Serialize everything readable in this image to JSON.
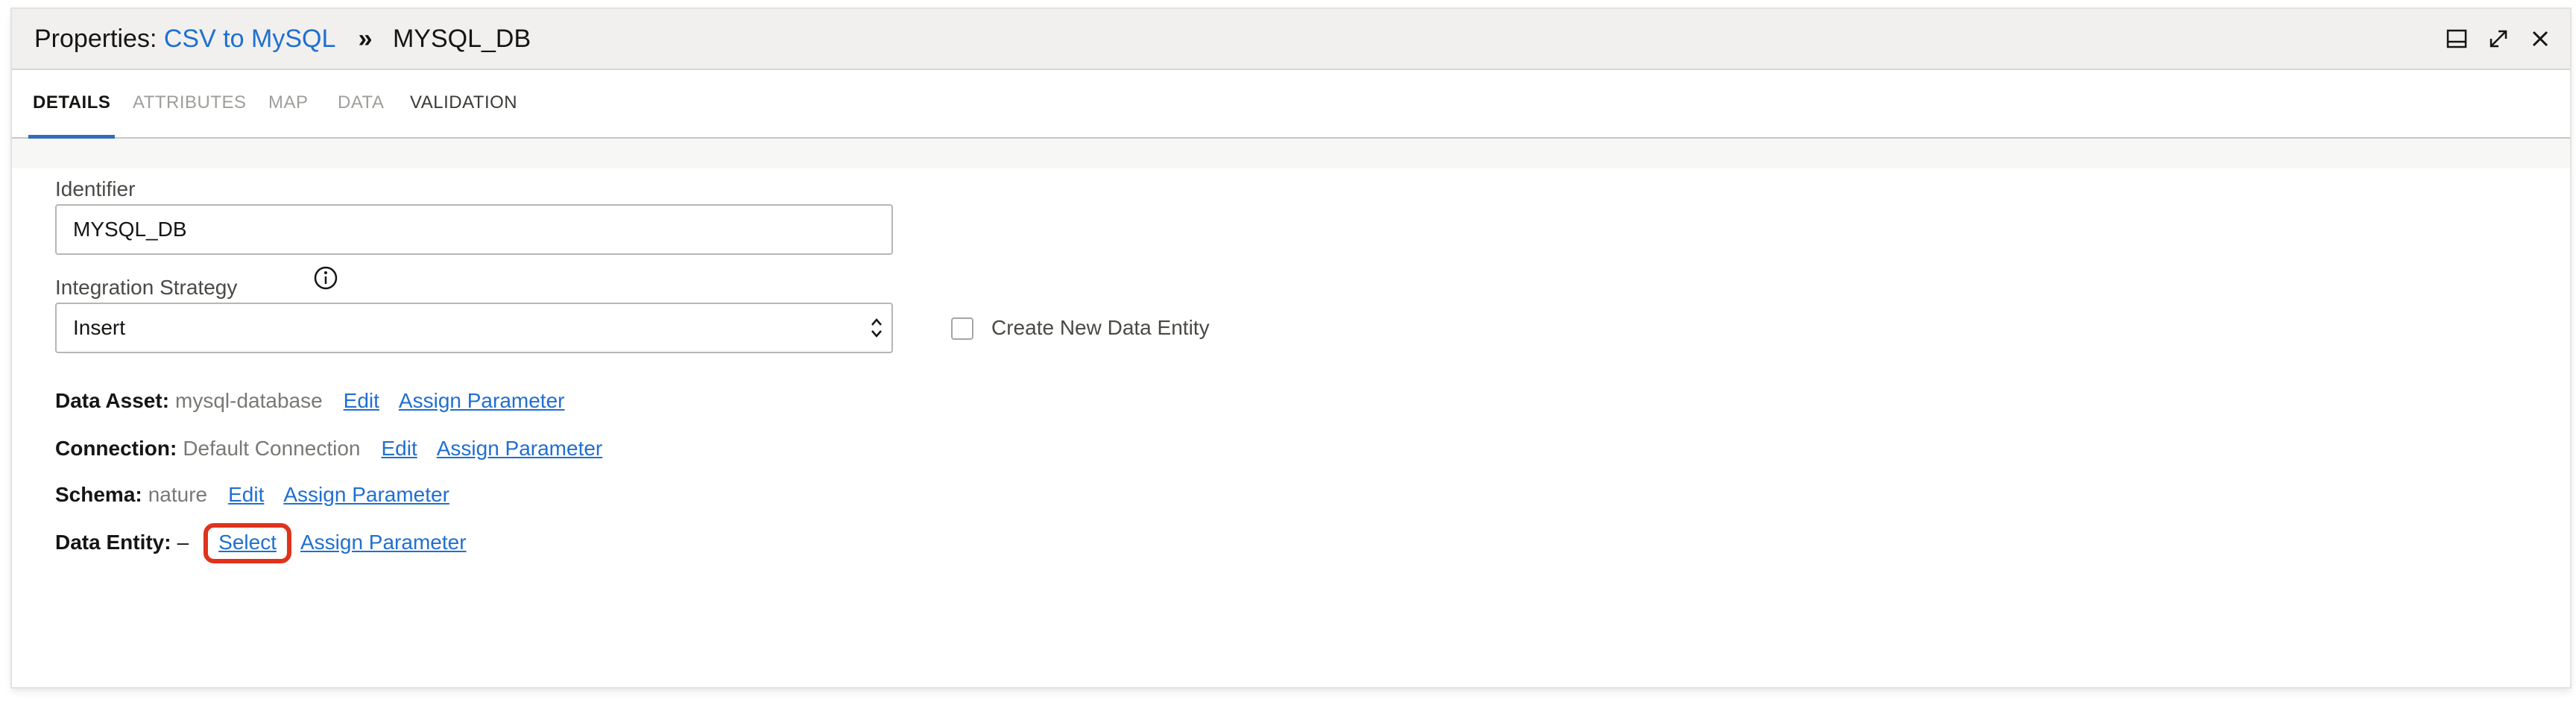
{
  "header": {
    "prefix": "Properties:",
    "link": "CSV to MySQL",
    "separator": "»",
    "current": "MYSQL_DB",
    "icons": [
      "dock-panel-icon",
      "expand-icon",
      "close-icon"
    ]
  },
  "tabs": [
    {
      "label": "DETAILS",
      "state": "active"
    },
    {
      "label": "ATTRIBUTES",
      "state": "disabled"
    },
    {
      "label": "MAP",
      "state": "disabled"
    },
    {
      "label": "DATA",
      "state": "disabled"
    },
    {
      "label": "VALIDATION",
      "state": "enabled"
    }
  ],
  "form": {
    "identifier_label": "Identifier",
    "identifier_value": "MYSQL_DB",
    "strategy_label": "Integration Strategy",
    "strategy_value": "Insert",
    "create_entity_label": "Create New Data Entity",
    "create_entity_checked": false
  },
  "details": {
    "data_asset": {
      "key": "Data Asset:",
      "value": "mysql-database",
      "edit": "Edit",
      "assign": "Assign Parameter"
    },
    "connection": {
      "key": "Connection:",
      "value": "Default Connection",
      "edit": "Edit",
      "assign": "Assign Parameter"
    },
    "schema": {
      "key": "Schema:",
      "value": "nature",
      "edit": "Edit",
      "assign": "Assign Parameter"
    },
    "data_entity": {
      "key": "Data Entity:",
      "value": "–",
      "select": "Select",
      "assign": "Assign Parameter"
    }
  },
  "colors": {
    "link": "#1f6fd1",
    "active_tab": "#2f6fb8",
    "highlight": "#e0321c"
  }
}
